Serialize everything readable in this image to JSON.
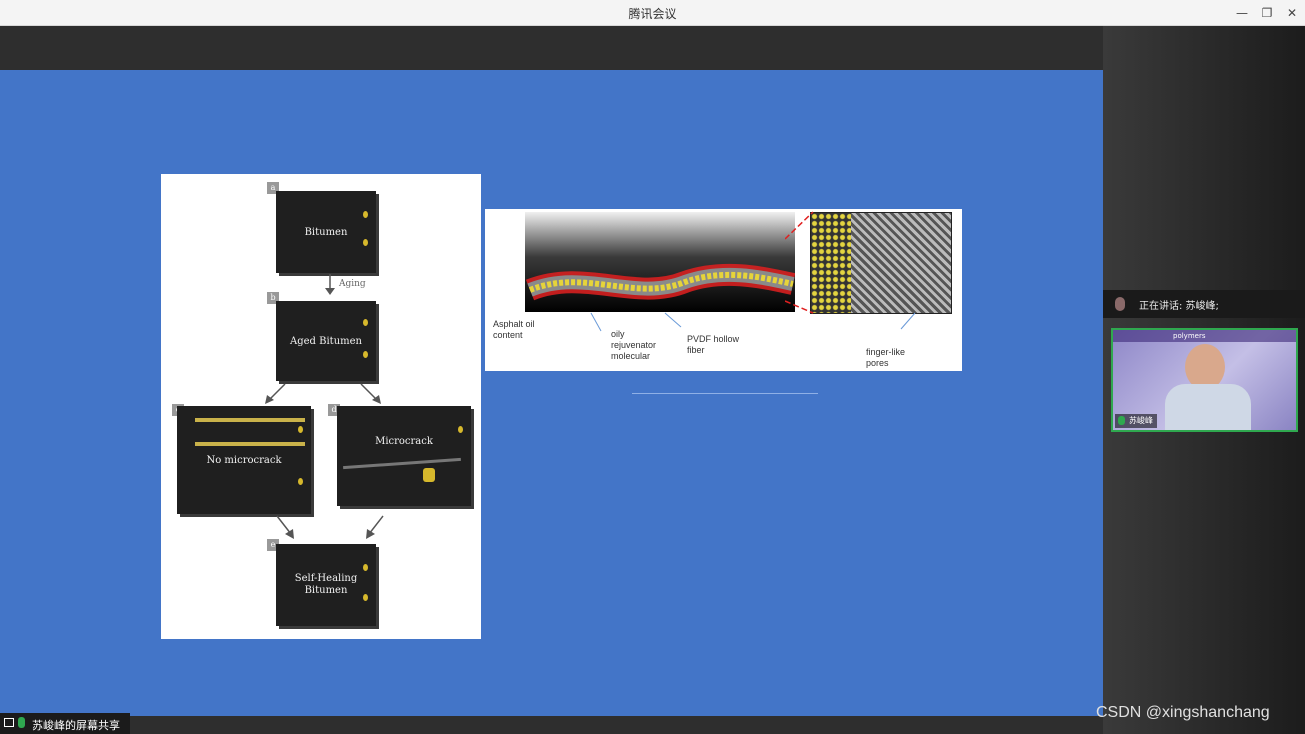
{
  "window": {
    "title": "腾讯会议",
    "minimize": "—",
    "restore": "❐",
    "close": "✕"
  },
  "slide": {
    "figure_a": {
      "tags": [
        "a",
        "b",
        "c",
        "d",
        "e"
      ],
      "cube_a": "Bitumen",
      "arrow_label": "Aging",
      "cube_b": "Aged Bitumen",
      "cube_c": "No microcrack",
      "cube_d": "Microcrack",
      "cube_e": "Self-Healing Bitumen"
    },
    "figure_b": {
      "label_asphalt": "Asphalt oil content",
      "label_oily": "oily rejuvenator molecular",
      "label_pvdf": "PVDF hollow fiber",
      "label_pores": "finger-like pores"
    }
  },
  "sidebar": {
    "speaking_label": "正在讲话: 苏峻峰;",
    "participant_name": "苏峻峰",
    "video_header": "polymers"
  },
  "share_bar": {
    "label": "苏峻峰的屏幕共享"
  },
  "watermark": "CSDN @xingshanchang",
  "colors": {
    "slide_bg": "#4375c8",
    "video_border": "#2fa84f",
    "cube": "#1f1f1f",
    "yellow_dots": "#d6b82c",
    "red_dash": "#e02020"
  }
}
